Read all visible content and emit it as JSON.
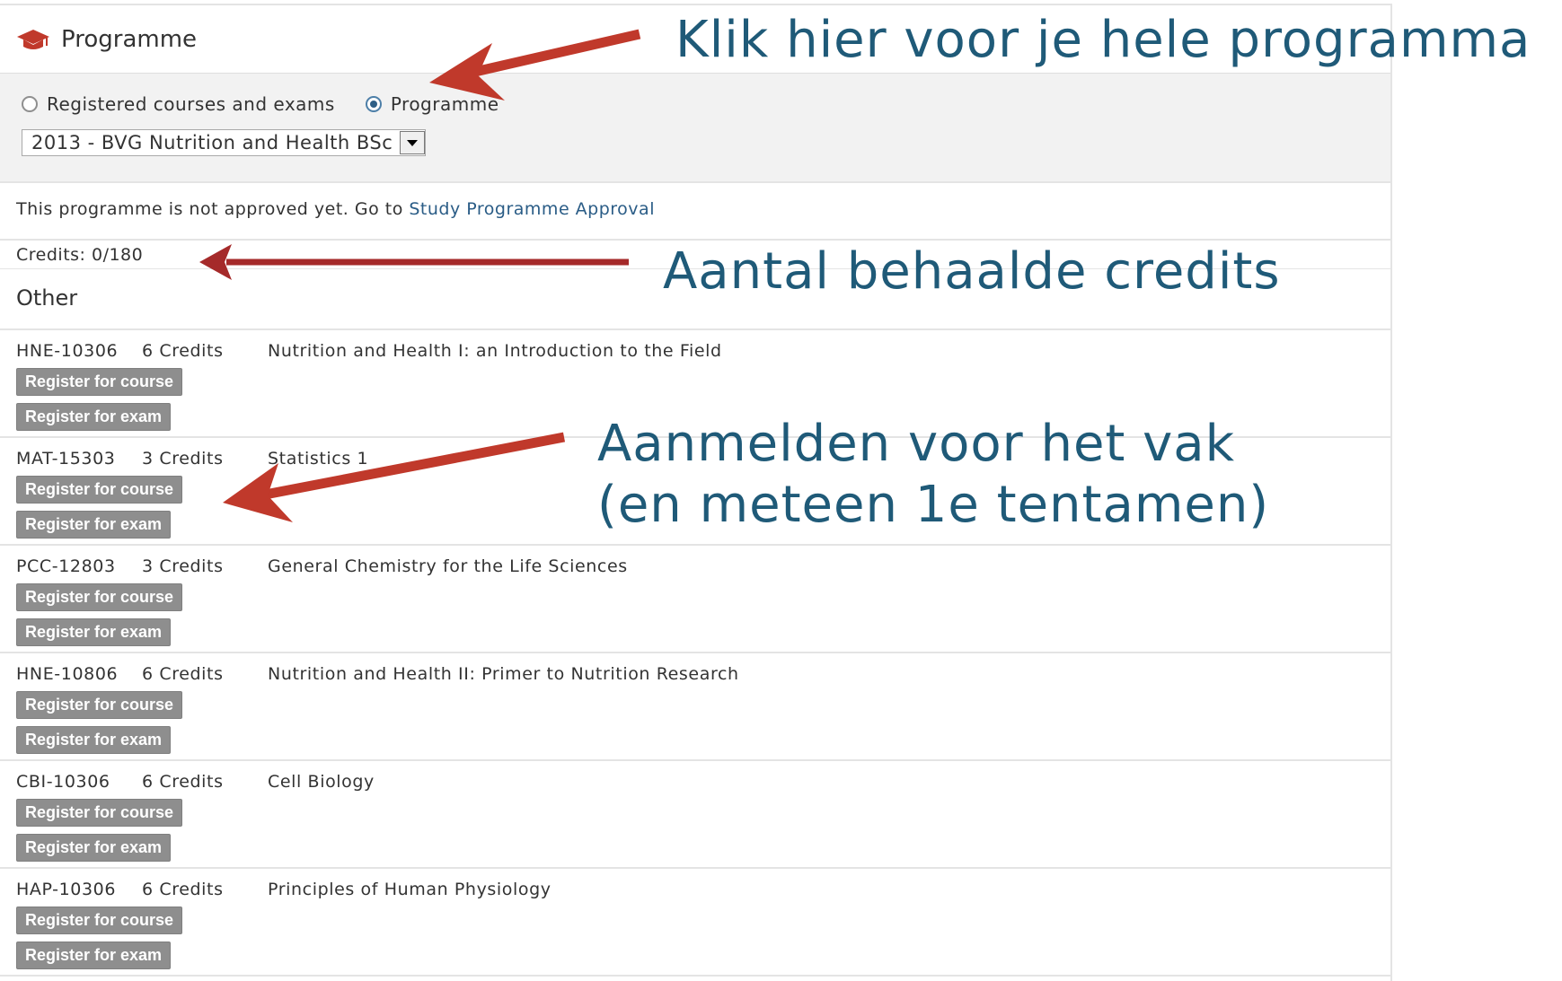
{
  "header": {
    "title": "Programme",
    "icon": "graduation-cap-icon"
  },
  "filters": {
    "options": [
      {
        "label": "Registered courses and exams",
        "selected": false
      },
      {
        "label": "Programme",
        "selected": true
      }
    ],
    "programme_select": "2013 - BVG Nutrition and Health BSc"
  },
  "notice": {
    "text": "This programme is not approved yet. Go to",
    "link": "Study Programme Approval"
  },
  "credits": "Credits: 0/180",
  "group": "Other",
  "buttons": {
    "course": "Register for course",
    "exam": "Register for exam"
  },
  "courses": [
    {
      "code": "HNE-10306",
      "credits": "6 Credits",
      "name": "Nutrition and Health I: an Introduction to the Field"
    },
    {
      "code": "MAT-15303",
      "credits": "3 Credits",
      "name": "Statistics 1"
    },
    {
      "code": "PCC-12803",
      "credits": "3 Credits",
      "name": "General Chemistry for the Life Sciences"
    },
    {
      "code": "HNE-10806",
      "credits": "6 Credits",
      "name": "Nutrition and Health II: Primer to Nutrition Research"
    },
    {
      "code": "CBI-10306",
      "credits": "6 Credits",
      "name": "Cell Biology"
    },
    {
      "code": "HAP-10306",
      "credits": "6 Credits",
      "name": "Principles of Human Physiology"
    }
  ],
  "annotations": {
    "programme": "Klik hier voor je hele programma",
    "credits": "Aantal behaalde credits",
    "register_line1": "Aanmelden voor het vak",
    "register_line2": "(en meteen 1e tentamen)"
  },
  "colors": {
    "annotation_text": "#1f5a78",
    "arrow": "#c0392b",
    "button": "#8e8e8e"
  }
}
